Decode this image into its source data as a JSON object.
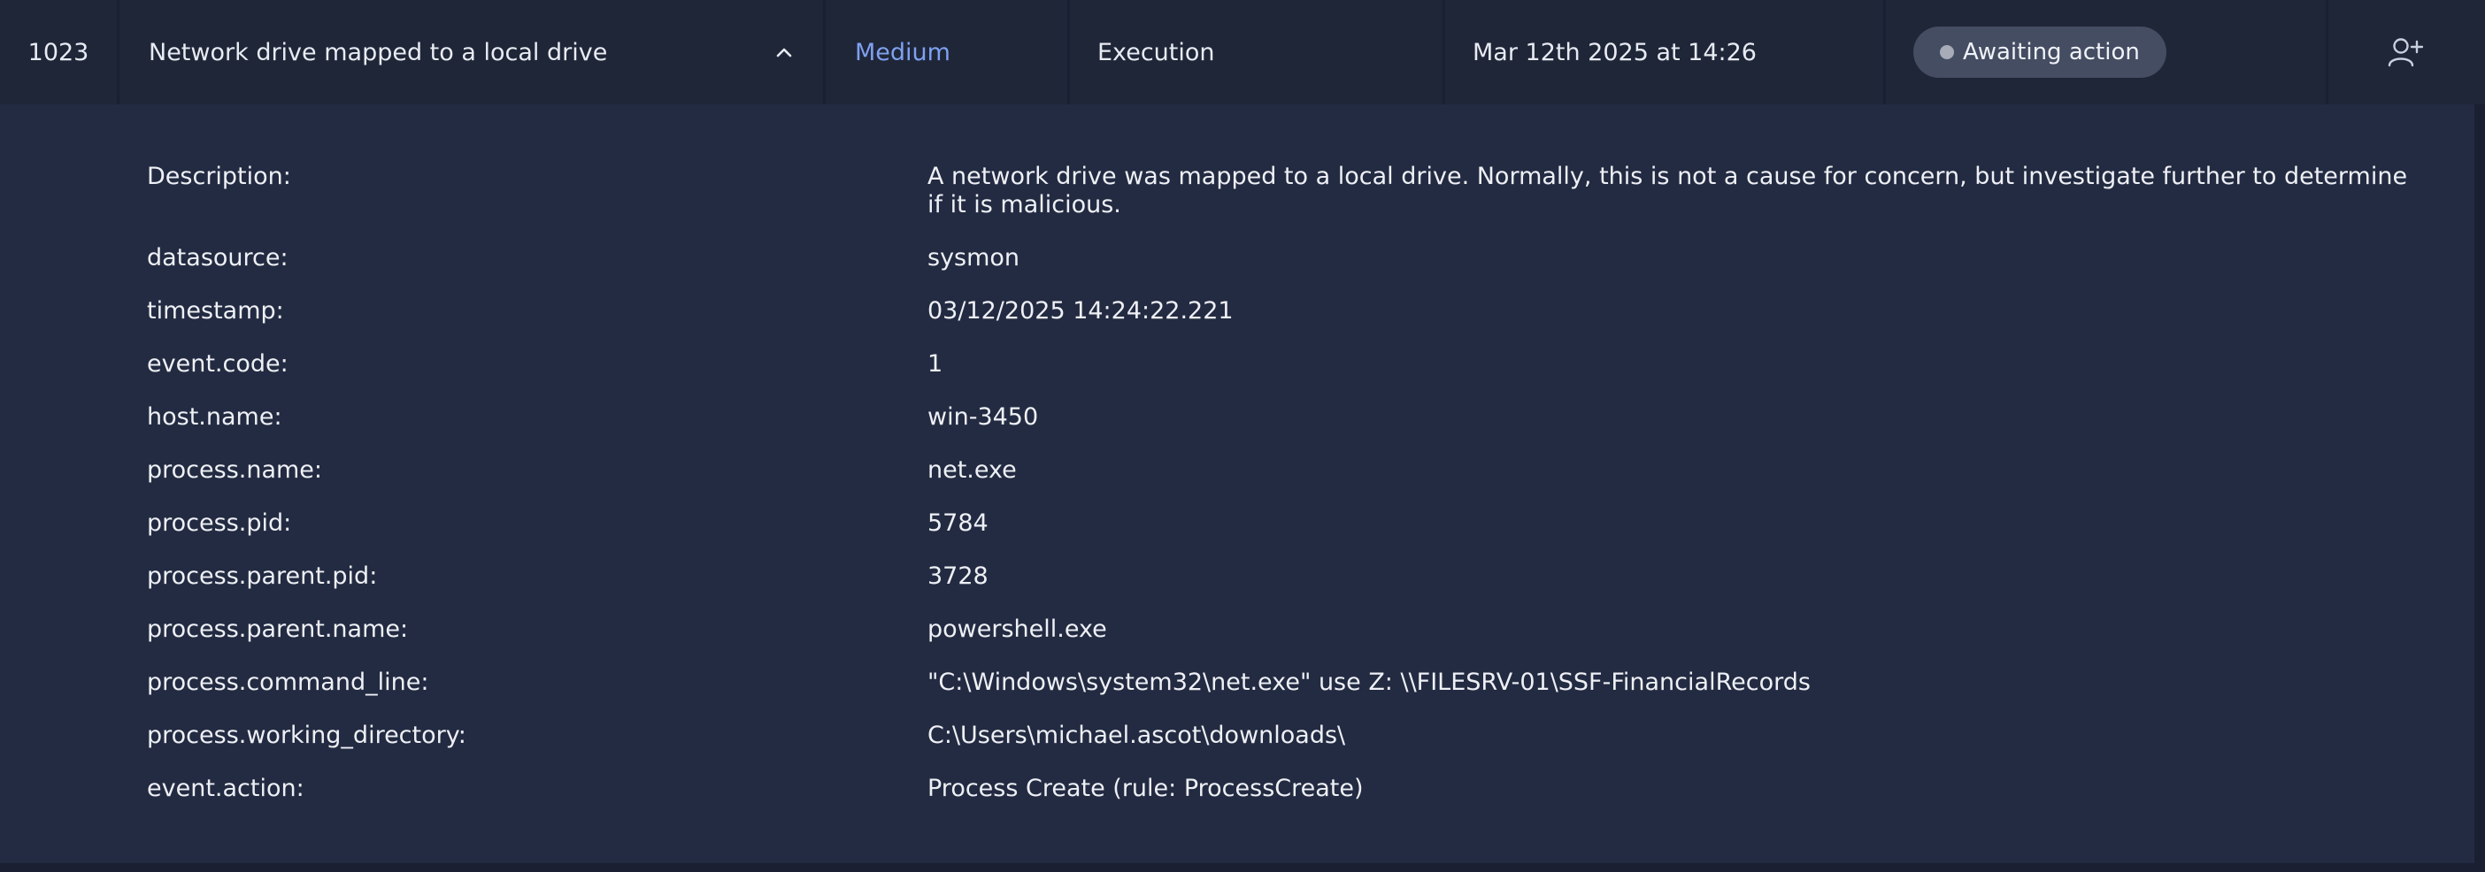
{
  "alert": {
    "id": "1023",
    "title": "Network drive mapped to a local drive",
    "severity": "Medium",
    "category": "Execution",
    "date": "Mar 12th 2025 at 14:26",
    "status": "Awaiting action",
    "colors": {
      "severity": "#7fa1f0",
      "status_bg": "#444d62",
      "status_dot": "#a7acb8",
      "row_bg": "#1f2638",
      "details_bg": "#232b42",
      "page_bg": "#1a2032"
    },
    "icons": {
      "expand": "chevron-up-icon",
      "assign": "add-user-icon"
    }
  },
  "details": [
    {
      "key": "Description:",
      "value": "A network drive was mapped to a local drive. Normally, this is not a cause for concern, but investigate further to determine if it is malicious."
    },
    {
      "key": "datasource:",
      "value": "sysmon"
    },
    {
      "key": "timestamp:",
      "value": "03/12/2025 14:24:22.221"
    },
    {
      "key": "event.code:",
      "value": "1"
    },
    {
      "key": "host.name:",
      "value": "win-3450"
    },
    {
      "key": "process.name:",
      "value": "net.exe"
    },
    {
      "key": "process.pid:",
      "value": "5784"
    },
    {
      "key": "process.parent.pid:",
      "value": "3728"
    },
    {
      "key": "process.parent.name:",
      "value": "powershell.exe"
    },
    {
      "key": "process.command_line:",
      "value": "\"C:\\Windows\\system32\\net.exe\" use Z: \\\\FILESRV-01\\SSF-FinancialRecords"
    },
    {
      "key": "process.working_directory:",
      "value": "C:\\Users\\michael.ascot\\downloads\\"
    },
    {
      "key": "event.action:",
      "value": "Process Create (rule: ProcessCreate)"
    }
  ]
}
